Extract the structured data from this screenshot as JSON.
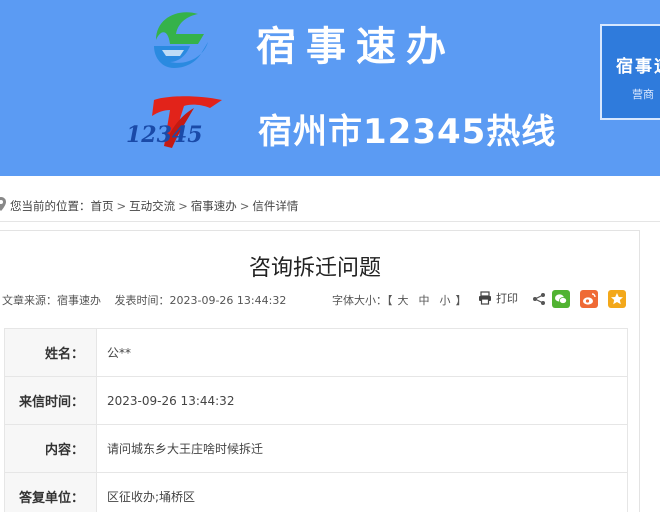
{
  "banner": {
    "title": "宿事速办",
    "subtitle": "宿州市12345热线",
    "logo_number": "12345",
    "side_card": {
      "title": "宿事速",
      "subtitle": "营商"
    },
    "background_color": "#5b9bf3"
  },
  "breadcrumb": {
    "prefix": "您当前的位置：",
    "items": [
      "首页",
      "互动交流",
      "宿事速办",
      "信件详情"
    ],
    "separator": ">"
  },
  "article": {
    "title": "咨询拆迁问题",
    "source": "文章来源：宿事速办",
    "publish_time": "发表时间：2023-09-26 13:44:32",
    "font_size_label": "字体大小：",
    "font_size_open": "【",
    "font_sizes": [
      "大",
      "中",
      "小"
    ],
    "font_size_close": "】",
    "print_label": "打印",
    "share_icons": [
      "share-icon",
      "wechat-icon",
      "weibo-icon",
      "favorite-icon"
    ]
  },
  "letter": {
    "rows": [
      {
        "label": "姓名：",
        "value": "公**"
      },
      {
        "label": "来信时间：",
        "value": "2023-09-26 13:44:32"
      },
      {
        "label": "内容：",
        "value": "请问城东乡大王庄啥时候拆迁"
      },
      {
        "label": "答复单位：",
        "value": "区征收办;埇桥区"
      }
    ]
  }
}
